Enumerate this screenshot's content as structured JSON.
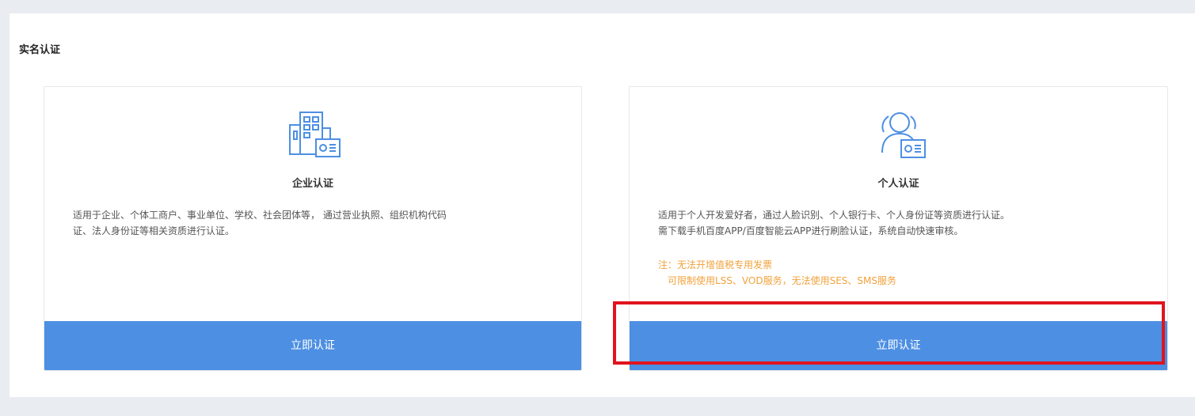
{
  "section": {
    "title": "实名认证"
  },
  "cards": [
    {
      "icon": "building-id-card-icon",
      "title": "企业认证",
      "description": [
        "适用于企业、个体工商户、事业单位、学校、社会团体等， 通过营业执照、组织机构代码",
        "证、法人身份证等相关资质进行认证。"
      ],
      "button": "立即认证"
    },
    {
      "icon": "person-id-card-icon",
      "title": "个人认证",
      "description": [
        "适用于个人开发爱好者，通过人脸识别、个人银行卡、个人身份证等资质进行认证。",
        "需下载手机百度APP/百度智能云APP进行刷脸认证，系统自动快速审核。"
      ],
      "note": [
        "注：无法开增值税专用发票",
        "可限制使用LSS、VOD服务，无法使用SES、SMS服务"
      ],
      "button": "立即认证"
    }
  ],
  "colors": {
    "accent": "#4d8fe3",
    "note": "#f1a23b",
    "highlight": "#e1141e",
    "background": "#e9ecf1"
  }
}
